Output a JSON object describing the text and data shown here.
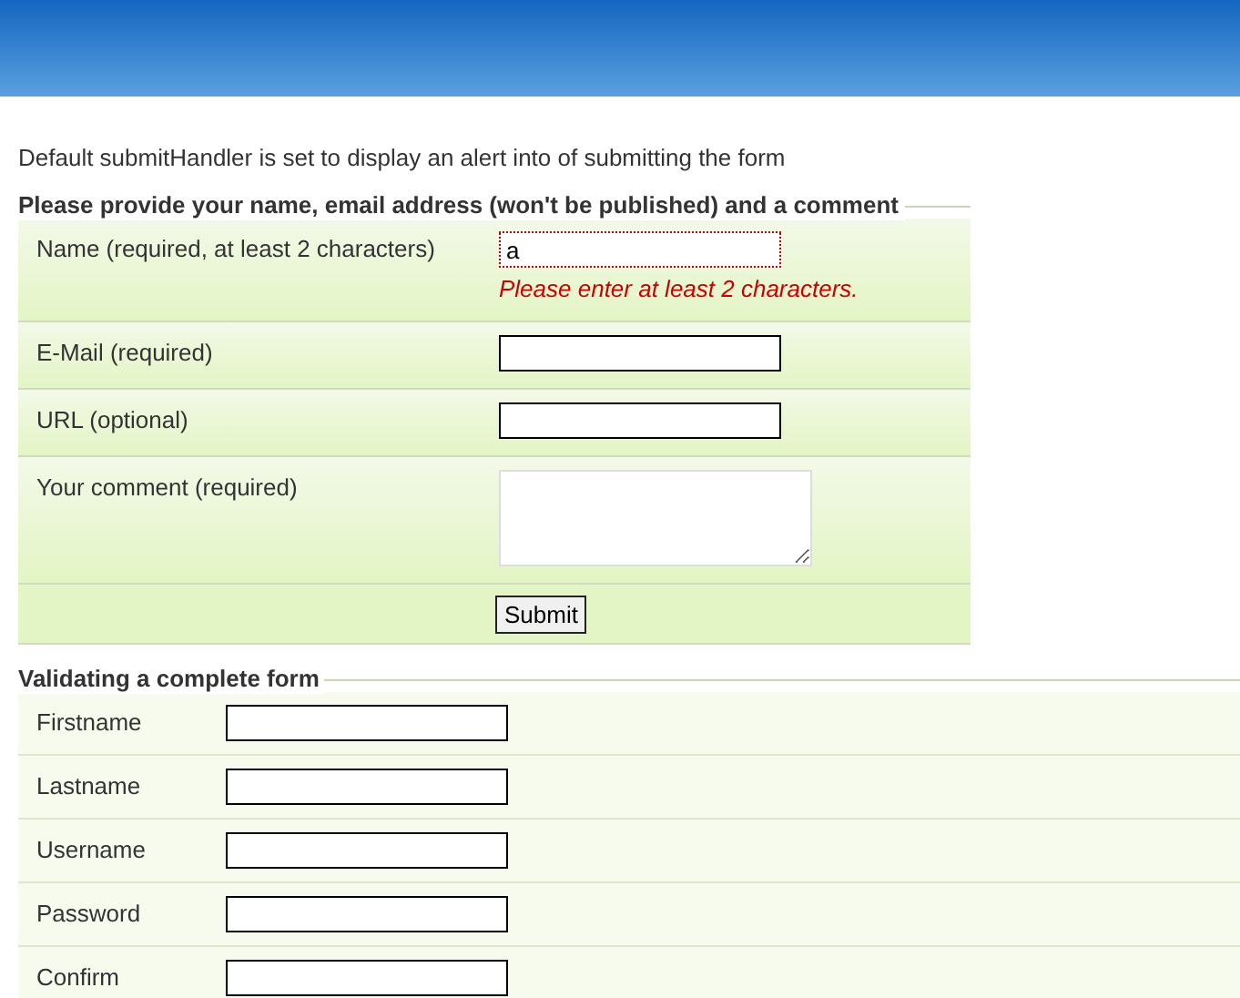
{
  "intro": "Default submitHandler is set to display an alert into of submitting the form",
  "comment_form": {
    "legend": "Please provide your name, email address (won't be published) and a comment",
    "fields": [
      {
        "kind": "text",
        "label": "Name (required, at least 2 characters)",
        "value": "a",
        "error": "Please enter at least 2 characters."
      },
      {
        "kind": "text",
        "label": "E-Mail (required)"
      },
      {
        "kind": "text",
        "label": "URL (optional)"
      },
      {
        "kind": "textarea",
        "label": "Your comment (required)"
      }
    ],
    "submit": "Submit"
  },
  "signup_form": {
    "legend": "Validating a complete form",
    "fields": [
      {
        "kind": "text",
        "label": "Firstname"
      },
      {
        "kind": "text",
        "label": "Lastname"
      },
      {
        "kind": "text",
        "label": "Username"
      },
      {
        "kind": "text",
        "label": "Password"
      },
      {
        "kind": "text",
        "label": "Confirm"
      }
    ]
  }
}
